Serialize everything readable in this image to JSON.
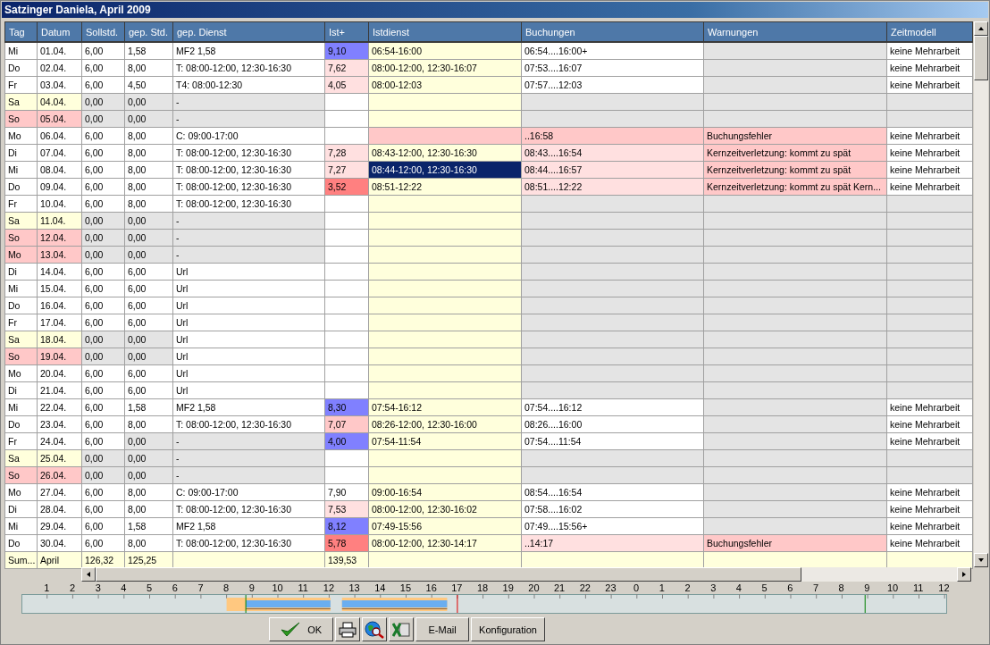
{
  "window": {
    "title": "Satzinger Daniela, April 2009"
  },
  "table": {
    "columns": [
      "Tag",
      "Datum",
      "Sollstd.",
      "gep. Std.",
      "gep. Dienst",
      "Ist+",
      "Istdienst",
      "Buchungen",
      "Warnungen",
      "Zeitmodell"
    ],
    "rows": [
      {
        "cells": [
          {
            "text": "Mi",
            "color": "#ffffff"
          },
          {
            "text": "01.04.",
            "color": "#ffffff"
          },
          {
            "text": "6,00",
            "color": "#ffffff"
          },
          {
            "text": "1,58",
            "color": "#ffffff"
          },
          {
            "text": "MF2 1,58",
            "color": "#ffffff"
          },
          {
            "text": "9,10",
            "color": "#8080ff"
          },
          {
            "text": "06:54-16:00",
            "color": "#ffffdc"
          },
          {
            "text": "06:54....16:00+",
            "color": "#ffffff"
          },
          {
            "color": "#e4e4e4"
          },
          {
            "text": "keine Mehrarbeit",
            "color": "#ffffff"
          }
        ]
      },
      {
        "cells": [
          {
            "text": "Do",
            "color": "#ffffff"
          },
          {
            "text": "02.04.",
            "color": "#ffffff"
          },
          {
            "text": "6,00",
            "color": "#ffffff"
          },
          {
            "text": "8,00",
            "color": "#ffffff"
          },
          {
            "text": "T: 08:00-12:00, 12:30-16:30",
            "color": "#ffffff"
          },
          {
            "text": "7,62",
            "color": "#ffe0e0"
          },
          {
            "text": "08:00-12:00, 12:30-16:07",
            "color": "#ffffdc"
          },
          {
            "text": "07:53....16:07",
            "color": "#ffffff"
          },
          {
            "color": "#e4e4e4"
          },
          {
            "text": "keine Mehrarbeit",
            "color": "#ffffff"
          }
        ]
      },
      {
        "cells": [
          {
            "text": "Fr",
            "color": "#ffffff"
          },
          {
            "text": "03.04.",
            "color": "#ffffff"
          },
          {
            "text": "6,00",
            "color": "#ffffff"
          },
          {
            "text": "4,50",
            "color": "#ffffff"
          },
          {
            "text": "T4: 08:00-12:30",
            "color": "#ffffff"
          },
          {
            "text": "4,05",
            "color": "#ffe0e0"
          },
          {
            "text": "08:00-12:03",
            "color": "#ffffdc"
          },
          {
            "text": "07:57....12:03",
            "color": "#ffffff"
          },
          {
            "color": "#e4e4e4"
          },
          {
            "text": "keine Mehrarbeit",
            "color": "#ffffff"
          }
        ]
      },
      {
        "cells": [
          {
            "text": "Sa",
            "color": "#ffffdc"
          },
          {
            "text": "04.04.",
            "color": "#ffffdc"
          },
          {
            "text": "0,00",
            "color": "#e4e4e4"
          },
          {
            "text": "0,00",
            "color": "#e4e4e4"
          },
          {
            "text": "-",
            "color": "#e4e4e4"
          },
          {
            "color": "#ffffff"
          },
          {
            "color": "#ffffdc"
          },
          {
            "color": "#e4e4e4"
          },
          {
            "color": "#e4e4e4"
          },
          {
            "color": "#e4e4e4"
          }
        ]
      },
      {
        "cells": [
          {
            "text": "So",
            "color": "#ffc8c8"
          },
          {
            "text": "05.04.",
            "color": "#ffc8c8"
          },
          {
            "text": "0,00",
            "color": "#e4e4e4"
          },
          {
            "text": "0,00",
            "color": "#e4e4e4"
          },
          {
            "text": "-",
            "color": "#e4e4e4"
          },
          {
            "color": "#ffffff"
          },
          {
            "color": "#ffffdc"
          },
          {
            "color": "#e4e4e4"
          },
          {
            "color": "#e4e4e4"
          },
          {
            "color": "#e4e4e4"
          }
        ]
      },
      {
        "cells": [
          {
            "text": "Mo",
            "color": "#ffffff"
          },
          {
            "text": "06.04.",
            "color": "#ffffff"
          },
          {
            "text": "6,00",
            "color": "#ffffff"
          },
          {
            "text": "8,00",
            "color": "#ffffff"
          },
          {
            "text": "C: 09:00-17:00",
            "color": "#ffffff"
          },
          {
            "color": "#ffffff"
          },
          {
            "color": "#ffc8c8"
          },
          {
            "text": "..16:58",
            "color": "#ffc8c8"
          },
          {
            "text": "Buchungsfehler",
            "color": "#ffc8c8"
          },
          {
            "text": "keine Mehrarbeit",
            "color": "#ffffff"
          }
        ]
      },
      {
        "cells": [
          {
            "text": "Di",
            "color": "#ffffff"
          },
          {
            "text": "07.04.",
            "color": "#ffffff"
          },
          {
            "text": "6,00",
            "color": "#ffffff"
          },
          {
            "text": "8,00",
            "color": "#ffffff"
          },
          {
            "text": "T: 08:00-12:00, 12:30-16:30",
            "color": "#ffffff"
          },
          {
            "text": "7,28",
            "color": "#ffe0e0"
          },
          {
            "text": "08:43-12:00, 12:30-16:30",
            "color": "#ffffdc"
          },
          {
            "text": "08:43....16:54",
            "color": "#ffe0e0"
          },
          {
            "text": "Kernzeitverletzung: kommt zu spät",
            "color": "#ffc8c8"
          },
          {
            "text": "keine Mehrarbeit",
            "color": "#ffffff"
          }
        ]
      },
      {
        "cells": [
          {
            "text": "Mi",
            "color": "#ffffff"
          },
          {
            "text": "08.04.",
            "color": "#ffffff"
          },
          {
            "text": "6,00",
            "color": "#ffffff"
          },
          {
            "text": "8,00",
            "color": "#ffffff"
          },
          {
            "text": "T: 08:00-12:00, 12:30-16:30",
            "color": "#ffffff"
          },
          {
            "text": "7,27",
            "color": "#ffe0e0"
          },
          {
            "text": "08:44-12:00, 12:30-16:30",
            "color": "#0a246a"
          },
          {
            "text": "08:44....16:57",
            "color": "#ffe0e0"
          },
          {
            "text": "Kernzeitverletzung: kommt zu spät",
            "color": "#ffc8c8"
          },
          {
            "text": "keine Mehrarbeit",
            "color": "#ffffff"
          }
        ]
      },
      {
        "cells": [
          {
            "text": "Do",
            "color": "#ffffff"
          },
          {
            "text": "09.04.",
            "color": "#ffffff"
          },
          {
            "text": "6,00",
            "color": "#ffffff"
          },
          {
            "text": "8,00",
            "color": "#ffffff"
          },
          {
            "text": "T: 08:00-12:00, 12:30-16:30",
            "color": "#ffffff"
          },
          {
            "text": "3,52",
            "color": "#ff8080"
          },
          {
            "text": "08:51-12:22",
            "color": "#ffffdc"
          },
          {
            "text": "08:51....12:22",
            "color": "#ffe0e0"
          },
          {
            "text": "Kernzeitverletzung: kommt zu spät Kern...",
            "color": "#ffc8c8"
          },
          {
            "text": "keine Mehrarbeit",
            "color": "#ffffff"
          }
        ]
      },
      {
        "cells": [
          {
            "text": "Fr",
            "color": "#ffffff"
          },
          {
            "text": "10.04.",
            "color": "#ffffff"
          },
          {
            "text": "6,00",
            "color": "#ffffff"
          },
          {
            "text": "8,00",
            "color": "#ffffff"
          },
          {
            "text": "T: 08:00-12:00, 12:30-16:30",
            "color": "#ffffff"
          },
          {
            "color": "#ffffff"
          },
          {
            "color": "#ffffdc"
          },
          {
            "color": "#e4e4e4"
          },
          {
            "color": "#e4e4e4"
          },
          {
            "color": "#e4e4e4"
          }
        ]
      },
      {
        "cells": [
          {
            "text": "Sa",
            "color": "#ffffdc"
          },
          {
            "text": "11.04.",
            "color": "#ffffdc"
          },
          {
            "text": "0,00",
            "color": "#e4e4e4"
          },
          {
            "text": "0,00",
            "color": "#e4e4e4"
          },
          {
            "text": "-",
            "color": "#e4e4e4"
          },
          {
            "color": "#ffffff"
          },
          {
            "color": "#ffffdc"
          },
          {
            "color": "#e4e4e4"
          },
          {
            "color": "#e4e4e4"
          },
          {
            "color": "#e4e4e4"
          }
        ]
      },
      {
        "cells": [
          {
            "text": "So",
            "color": "#ffc8c8"
          },
          {
            "text": "12.04.",
            "color": "#ffc8c8"
          },
          {
            "text": "0,00",
            "color": "#e4e4e4"
          },
          {
            "text": "0,00",
            "color": "#e4e4e4"
          },
          {
            "text": "-",
            "color": "#e4e4e4"
          },
          {
            "color": "#ffffff"
          },
          {
            "color": "#ffffdc"
          },
          {
            "color": "#e4e4e4"
          },
          {
            "color": "#e4e4e4"
          },
          {
            "color": "#e4e4e4"
          }
        ]
      },
      {
        "cells": [
          {
            "text": "Mo",
            "color": "#ffc8c8"
          },
          {
            "text": "13.04.",
            "color": "#ffc8c8"
          },
          {
            "text": "0,00",
            "color": "#e4e4e4"
          },
          {
            "text": "0,00",
            "color": "#e4e4e4"
          },
          {
            "text": "-",
            "color": "#e4e4e4"
          },
          {
            "color": "#ffffff"
          },
          {
            "color": "#ffffdc"
          },
          {
            "color": "#e4e4e4"
          },
          {
            "color": "#e4e4e4"
          },
          {
            "color": "#e4e4e4"
          }
        ]
      },
      {
        "cells": [
          {
            "text": "Di",
            "color": "#ffffff"
          },
          {
            "text": "14.04.",
            "color": "#ffffff"
          },
          {
            "text": "6,00",
            "color": "#ffffff"
          },
          {
            "text": "6,00",
            "color": "#ffffff"
          },
          {
            "text": "Url",
            "color": "#ffffff"
          },
          {
            "color": "#ffffff"
          },
          {
            "color": "#ffffdc"
          },
          {
            "color": "#e4e4e4"
          },
          {
            "color": "#e4e4e4"
          },
          {
            "color": "#e4e4e4"
          }
        ]
      },
      {
        "cells": [
          {
            "text": "Mi",
            "color": "#ffffff"
          },
          {
            "text": "15.04.",
            "color": "#ffffff"
          },
          {
            "text": "6,00",
            "color": "#ffffff"
          },
          {
            "text": "6,00",
            "color": "#ffffff"
          },
          {
            "text": "Url",
            "color": "#ffffff"
          },
          {
            "color": "#ffffff"
          },
          {
            "color": "#ffffdc"
          },
          {
            "color": "#e4e4e4"
          },
          {
            "color": "#e4e4e4"
          },
          {
            "color": "#e4e4e4"
          }
        ]
      },
      {
        "cells": [
          {
            "text": "Do",
            "color": "#ffffff"
          },
          {
            "text": "16.04.",
            "color": "#ffffff"
          },
          {
            "text": "6,00",
            "color": "#ffffff"
          },
          {
            "text": "6,00",
            "color": "#ffffff"
          },
          {
            "text": "Url",
            "color": "#ffffff"
          },
          {
            "color": "#ffffff"
          },
          {
            "color": "#ffffdc"
          },
          {
            "color": "#e4e4e4"
          },
          {
            "color": "#e4e4e4"
          },
          {
            "color": "#e4e4e4"
          }
        ]
      },
      {
        "cells": [
          {
            "text": "Fr",
            "color": "#ffffff"
          },
          {
            "text": "17.04.",
            "color": "#ffffff"
          },
          {
            "text": "6,00",
            "color": "#ffffff"
          },
          {
            "text": "6,00",
            "color": "#ffffff"
          },
          {
            "text": "Url",
            "color": "#ffffff"
          },
          {
            "color": "#ffffff"
          },
          {
            "color": "#ffffdc"
          },
          {
            "color": "#e4e4e4"
          },
          {
            "color": "#e4e4e4"
          },
          {
            "color": "#e4e4e4"
          }
        ]
      },
      {
        "cells": [
          {
            "text": "Sa",
            "color": "#ffffdc"
          },
          {
            "text": "18.04.",
            "color": "#ffffdc"
          },
          {
            "text": "0,00",
            "color": "#e4e4e4"
          },
          {
            "text": "0,00",
            "color": "#e4e4e4"
          },
          {
            "text": "Url",
            "color": "#ffffff"
          },
          {
            "color": "#ffffff"
          },
          {
            "color": "#ffffdc"
          },
          {
            "color": "#e4e4e4"
          },
          {
            "color": "#e4e4e4"
          },
          {
            "color": "#e4e4e4"
          }
        ]
      },
      {
        "cells": [
          {
            "text": "So",
            "color": "#ffc8c8"
          },
          {
            "text": "19.04.",
            "color": "#ffc8c8"
          },
          {
            "text": "0,00",
            "color": "#e4e4e4"
          },
          {
            "text": "0,00",
            "color": "#e4e4e4"
          },
          {
            "text": "Url",
            "color": "#ffffff"
          },
          {
            "color": "#ffffff"
          },
          {
            "color": "#ffffdc"
          },
          {
            "color": "#e4e4e4"
          },
          {
            "color": "#e4e4e4"
          },
          {
            "color": "#e4e4e4"
          }
        ]
      },
      {
        "cells": [
          {
            "text": "Mo",
            "color": "#ffffff"
          },
          {
            "text": "20.04.",
            "color": "#ffffff"
          },
          {
            "text": "6,00",
            "color": "#ffffff"
          },
          {
            "text": "6,00",
            "color": "#ffffff"
          },
          {
            "text": "Url",
            "color": "#ffffff"
          },
          {
            "color": "#ffffff"
          },
          {
            "color": "#ffffdc"
          },
          {
            "color": "#e4e4e4"
          },
          {
            "color": "#e4e4e4"
          },
          {
            "color": "#e4e4e4"
          }
        ]
      },
      {
        "cells": [
          {
            "text": "Di",
            "color": "#ffffff"
          },
          {
            "text": "21.04.",
            "color": "#ffffff"
          },
          {
            "text": "6,00",
            "color": "#ffffff"
          },
          {
            "text": "6,00",
            "color": "#ffffff"
          },
          {
            "text": "Url",
            "color": "#ffffff"
          },
          {
            "color": "#ffffff"
          },
          {
            "color": "#ffffdc"
          },
          {
            "color": "#e4e4e4"
          },
          {
            "color": "#e4e4e4"
          },
          {
            "color": "#e4e4e4"
          }
        ]
      },
      {
        "cells": [
          {
            "text": "Mi",
            "color": "#ffffff"
          },
          {
            "text": "22.04.",
            "color": "#ffffff"
          },
          {
            "text": "6,00",
            "color": "#ffffff"
          },
          {
            "text": "1,58",
            "color": "#ffffff"
          },
          {
            "text": "MF2 1,58",
            "color": "#ffffff"
          },
          {
            "text": "8,30",
            "color": "#8080ff"
          },
          {
            "text": "07:54-16:12",
            "color": "#ffffdc"
          },
          {
            "text": "07:54....16:12",
            "color": "#ffffff"
          },
          {
            "color": "#e4e4e4"
          },
          {
            "text": "keine Mehrarbeit",
            "color": "#ffffff"
          }
        ]
      },
      {
        "cells": [
          {
            "text": "Do",
            "color": "#ffffff"
          },
          {
            "text": "23.04.",
            "color": "#ffffff"
          },
          {
            "text": "6,00",
            "color": "#ffffff"
          },
          {
            "text": "8,00",
            "color": "#ffffff"
          },
          {
            "text": "T: 08:00-12:00, 12:30-16:30",
            "color": "#ffffff"
          },
          {
            "text": "7,07",
            "color": "#ffc8c8"
          },
          {
            "text": "08:26-12:00, 12:30-16:00",
            "color": "#ffffdc"
          },
          {
            "text": "08:26....16:00",
            "color": "#ffffff"
          },
          {
            "color": "#e4e4e4"
          },
          {
            "text": "keine Mehrarbeit",
            "color": "#ffffff"
          }
        ]
      },
      {
        "cells": [
          {
            "text": "Fr",
            "color": "#ffffff"
          },
          {
            "text": "24.04.",
            "color": "#ffffff"
          },
          {
            "text": "6,00",
            "color": "#ffffff"
          },
          {
            "text": "0,00",
            "color": "#e4e4e4"
          },
          {
            "text": "-",
            "color": "#e4e4e4"
          },
          {
            "text": "4,00",
            "color": "#8080ff"
          },
          {
            "text": "07:54-11:54",
            "color": "#ffffdc"
          },
          {
            "text": "07:54....11:54",
            "color": "#ffffff"
          },
          {
            "color": "#e4e4e4"
          },
          {
            "text": "keine Mehrarbeit",
            "color": "#ffffff"
          }
        ]
      },
      {
        "cells": [
          {
            "text": "Sa",
            "color": "#ffffdc"
          },
          {
            "text": "25.04.",
            "color": "#ffffdc"
          },
          {
            "text": "0,00",
            "color": "#e4e4e4"
          },
          {
            "text": "0,00",
            "color": "#e4e4e4"
          },
          {
            "text": "-",
            "color": "#e4e4e4"
          },
          {
            "color": "#ffffff"
          },
          {
            "color": "#ffffdc"
          },
          {
            "color": "#e4e4e4"
          },
          {
            "color": "#e4e4e4"
          },
          {
            "color": "#e4e4e4"
          }
        ]
      },
      {
        "cells": [
          {
            "text": "So",
            "color": "#ffc8c8"
          },
          {
            "text": "26.04.",
            "color": "#ffc8c8"
          },
          {
            "text": "0,00",
            "color": "#e4e4e4"
          },
          {
            "text": "0,00",
            "color": "#e4e4e4"
          },
          {
            "text": "-",
            "color": "#e4e4e4"
          },
          {
            "color": "#ffffff"
          },
          {
            "color": "#ffffdc"
          },
          {
            "color": "#e4e4e4"
          },
          {
            "color": "#e4e4e4"
          },
          {
            "color": "#e4e4e4"
          }
        ]
      },
      {
        "cells": [
          {
            "text": "Mo",
            "color": "#ffffff"
          },
          {
            "text": "27.04.",
            "color": "#ffffff"
          },
          {
            "text": "6,00",
            "color": "#ffffff"
          },
          {
            "text": "8,00",
            "color": "#ffffff"
          },
          {
            "text": "C: 09:00-17:00",
            "color": "#ffffff"
          },
          {
            "text": "7,90",
            "color": "#ffffff"
          },
          {
            "text": "09:00-16:54",
            "color": "#ffffdc"
          },
          {
            "text": "08:54....16:54",
            "color": "#ffffff"
          },
          {
            "color": "#e4e4e4"
          },
          {
            "text": "keine Mehrarbeit",
            "color": "#ffffff"
          }
        ]
      },
      {
        "cells": [
          {
            "text": "Di",
            "color": "#ffffff"
          },
          {
            "text": "28.04.",
            "color": "#ffffff"
          },
          {
            "text": "6,00",
            "color": "#ffffff"
          },
          {
            "text": "8,00",
            "color": "#ffffff"
          },
          {
            "text": "T: 08:00-12:00, 12:30-16:30",
            "color": "#ffffff"
          },
          {
            "text": "7,53",
            "color": "#ffe0e0"
          },
          {
            "text": "08:00-12:00, 12:30-16:02",
            "color": "#ffffdc"
          },
          {
            "text": "07:58....16:02",
            "color": "#ffffff"
          },
          {
            "color": "#e4e4e4"
          },
          {
            "text": "keine Mehrarbeit",
            "color": "#ffffff"
          }
        ]
      },
      {
        "cells": [
          {
            "text": "Mi",
            "color": "#ffffff"
          },
          {
            "text": "29.04.",
            "color": "#ffffff"
          },
          {
            "text": "6,00",
            "color": "#ffffff"
          },
          {
            "text": "1,58",
            "color": "#ffffff"
          },
          {
            "text": "MF2 1,58",
            "color": "#ffffff"
          },
          {
            "text": "8,12",
            "color": "#8080ff"
          },
          {
            "text": "07:49-15:56",
            "color": "#ffffdc"
          },
          {
            "text": "07:49....15:56+",
            "color": "#ffffff"
          },
          {
            "color": "#e4e4e4"
          },
          {
            "text": "keine Mehrarbeit",
            "color": "#ffffff"
          }
        ]
      },
      {
        "cells": [
          {
            "text": "Do",
            "color": "#ffffff"
          },
          {
            "text": "30.04.",
            "color": "#ffffff"
          },
          {
            "text": "6,00",
            "color": "#ffffff"
          },
          {
            "text": "8,00",
            "color": "#ffffff"
          },
          {
            "text": "T: 08:00-12:00, 12:30-16:30",
            "color": "#ffffff"
          },
          {
            "text": "5,78",
            "color": "#ff8080"
          },
          {
            "text": "08:00-12:00, 12:30-14:17",
            "color": "#ffffdc"
          },
          {
            "text": "..14:17",
            "color": "#ffe0e0"
          },
          {
            "text": "Buchungsfehler",
            "color": "#ffc8c8"
          },
          {
            "text": "keine Mehrarbeit",
            "color": "#ffffff"
          }
        ]
      },
      {
        "cells": [
          {
            "text": "Sum...",
            "color": "#ffffdc"
          },
          {
            "text": "April",
            "color": "#ffffdc"
          },
          {
            "text": "126,32",
            "color": "#ffffdc"
          },
          {
            "text": "125,25",
            "color": "#ffffdc"
          },
          {
            "color": "#ffffdc"
          },
          {
            "text": "139,53",
            "color": "#ffffdc"
          },
          {
            "color": "#ffffdc"
          },
          {
            "color": "#ffffdc"
          },
          {
            "color": "#ffffdc"
          },
          {
            "color": "#ffffdc"
          }
        ]
      }
    ]
  },
  "timeline": {
    "hours": [
      "1",
      "2",
      "3",
      "4",
      "5",
      "6",
      "7",
      "8",
      "9",
      "10",
      "11",
      "12",
      "13",
      "14",
      "15",
      "16",
      "17",
      "18",
      "19",
      "20",
      "21",
      "22",
      "23",
      "0",
      "1",
      "2",
      "3",
      "4",
      "5",
      "6",
      "7",
      "8",
      "9",
      "10",
      "11",
      "12"
    ]
  },
  "buttons": [
    {
      "kind": "ok",
      "label": "OK"
    },
    {
      "kind": "print"
    },
    {
      "kind": "preview"
    },
    {
      "kind": "excel"
    },
    {
      "kind": "text",
      "label": "E-Mail"
    },
    {
      "kind": "text",
      "label": "Konfiguration"
    }
  ]
}
